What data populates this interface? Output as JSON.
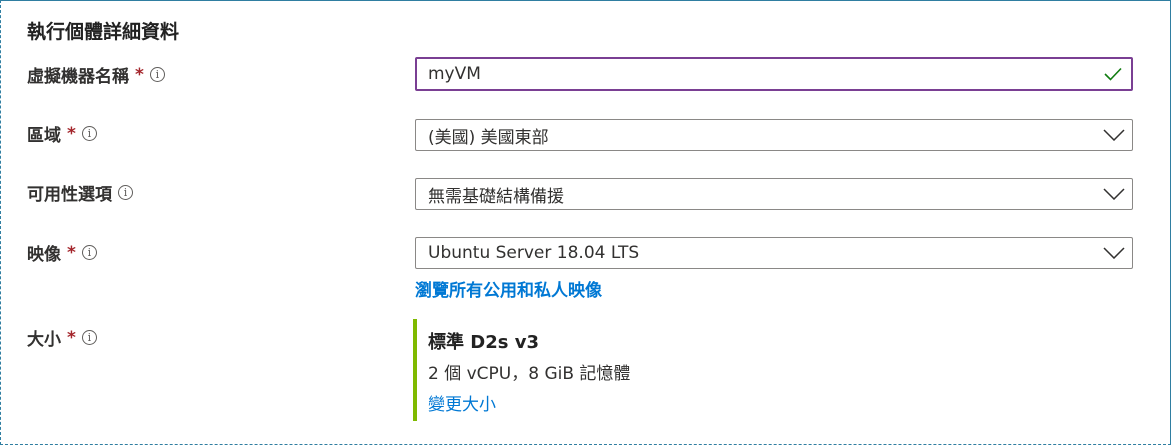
{
  "section_title": "執行個體詳細資料",
  "required_mark": "*",
  "info_glyph": "i",
  "vm_name": {
    "label": "虛擬機器名稱",
    "value": "myVM"
  },
  "region": {
    "label": "區域",
    "value": "(美國) 美國東部"
  },
  "availability": {
    "label": "可用性選項",
    "value": "無需基礎結構備援"
  },
  "image": {
    "label": "映像",
    "value": "Ubuntu Server 18.04 LTS",
    "browse_link": "瀏覽所有公用和私人映像"
  },
  "size": {
    "label": "大小",
    "name": "標準 D2s v3",
    "spec": "2 個 vCPU，8 GiB 記憶體",
    "change_link": "變更大小"
  },
  "colors": {
    "focus_border": "#7a3f93",
    "valid_check": "#107c10",
    "link": "#0078d4",
    "required": "#a4262c",
    "size_accent": "#7fba00"
  }
}
